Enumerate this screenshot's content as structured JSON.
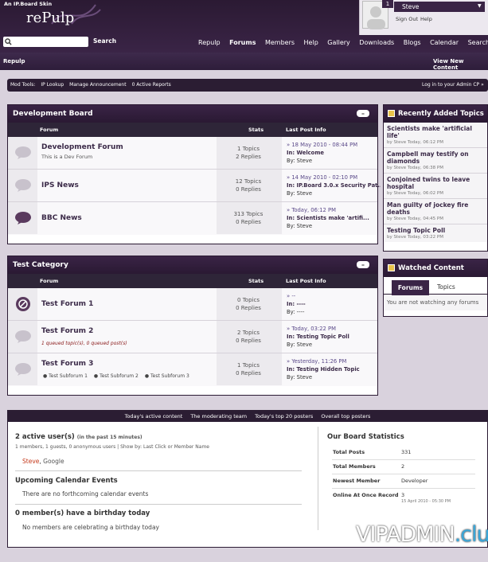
{
  "header": {
    "skin_label": "An IP.Board Skin",
    "logo": "rePulp",
    "search_placeholder": "",
    "search_button": "Search",
    "nav": [
      "Repulp",
      "Forums",
      "Members",
      "Help",
      "Gallery",
      "Downloads",
      "Blogs",
      "Calendar",
      "Search"
    ],
    "active_nav": "Forums"
  },
  "user": {
    "badge": "1",
    "name": "Steve",
    "sign_out": "Sign Out",
    "help": "Help"
  },
  "subnav": {
    "breadcrumb": "Repulp",
    "view_new": "View New Content"
  },
  "modbar": {
    "items": [
      "Mod Tools:",
      "IP Lookup",
      "Manage Announcement",
      "0 Active Reports"
    ],
    "admin": "Log in to your Admin CP »"
  },
  "categories": [
    {
      "title": "Development Board",
      "columns": [
        "Forum",
        "Stats",
        "Last Post Info"
      ],
      "forums": [
        {
          "name": "Development Forum",
          "desc": "This is a Dev Forum",
          "topics": "1 Topics",
          "replies": "2 Replies",
          "date": "» 18 May 2010 - 08:44 PM",
          "in": "In: Welcome",
          "by": "By: Steve"
        },
        {
          "name": "IPS News",
          "desc": "",
          "topics": "12 Topics",
          "replies": "0 Replies",
          "date": "» 14 May 2010 - 02:10 PM",
          "in": "In: IP.Board 3.0.x Security Pat...",
          "by": "By: Steve"
        },
        {
          "name": "BBC News",
          "desc": "",
          "topics": "313 Topics",
          "replies": "0 Replies",
          "date": "» Today, 06:12 PM",
          "in": "In: Scientists make 'artifi...",
          "by": "By: Steve"
        }
      ]
    },
    {
      "title": "Test Category",
      "columns": [
        "Forum",
        "Stats",
        "Last Post Info"
      ],
      "forums": [
        {
          "name": "Test Forum 1",
          "desc": "",
          "topics": "0 Topics",
          "replies": "0 Replies",
          "date": "» --",
          "in": "In: ----",
          "by": "By: ----"
        },
        {
          "name": "Test Forum 2",
          "queue": "1 queued topic(s), 0 queued post(s)",
          "topics": "2 Topics",
          "replies": "0 Replies",
          "date": "» Today, 03:22 PM",
          "in": "In: Testing Topic Poll",
          "by": "By: Steve"
        },
        {
          "name": "Test Forum 3",
          "subforums": [
            "Test Subforum 1",
            "Test Subforum 2",
            "Test Subforum 3"
          ],
          "topics": "1 Topics",
          "replies": "0 Replies",
          "date": "» Yesterday, 11:26 PM",
          "in": "In: Testing Hidden Topic",
          "by": "By: Steve"
        }
      ]
    }
  ],
  "recent": {
    "title": "Recently Added Topics",
    "items": [
      {
        "title": "Scientists make 'artificial life'",
        "meta": "by Steve Today, 06:12 PM"
      },
      {
        "title": "Campbell may testify on diamonds",
        "meta": "by Steve Today, 06:38 PM"
      },
      {
        "title": "Conjoined twins to leave hospital",
        "meta": "by Steve Today, 06:02 PM"
      },
      {
        "title": "Man guilty of jockey fire deaths",
        "meta": "by Steve Today, 04:45 PM"
      },
      {
        "title": "Testing Topic Poll",
        "meta": "by Steve Today, 03:22 PM"
      }
    ]
  },
  "watched": {
    "title": "Watched Content",
    "tabs": [
      "Forums",
      "Topics"
    ],
    "empty": "You are not watching any forums"
  },
  "statsbar": [
    "Today's active content",
    "The moderating team",
    "Today's top 20 posters",
    "Overall top posters"
  ],
  "stats": {
    "active_title": "2 active user(s)",
    "active_sub": "(in the past 15 minutes)",
    "active_detail": "1 members, 1 guests, 0 anonymous users | Show by: Last Click or Member Name",
    "active_users_member": "Steve",
    "active_users_sep": ", ",
    "active_users_guest": "Google",
    "calendar_title": "Upcoming Calendar Events",
    "calendar_text": "There are no forthcoming calendar events",
    "birthday_title": "0 member(s) have a birthday today",
    "birthday_text": "No members are celebrating a birthday today",
    "board_title": "Our Board Statistics",
    "rows": [
      {
        "k": "Total Posts",
        "v": "331"
      },
      {
        "k": "Total Members",
        "v": "2"
      },
      {
        "k": "Newest Member",
        "v": "Developer"
      },
      {
        "k": "Online At Once Record",
        "v": "3",
        "sub": "15 April 2010 - 05:30 PM"
      }
    ]
  },
  "watermark": {
    "main": "VIPADMIN",
    "suffix": ".club"
  },
  "colors": {
    "accent": "#3a2446",
    "dark": "#2b1a33",
    "bg": "#d9d2dd"
  }
}
